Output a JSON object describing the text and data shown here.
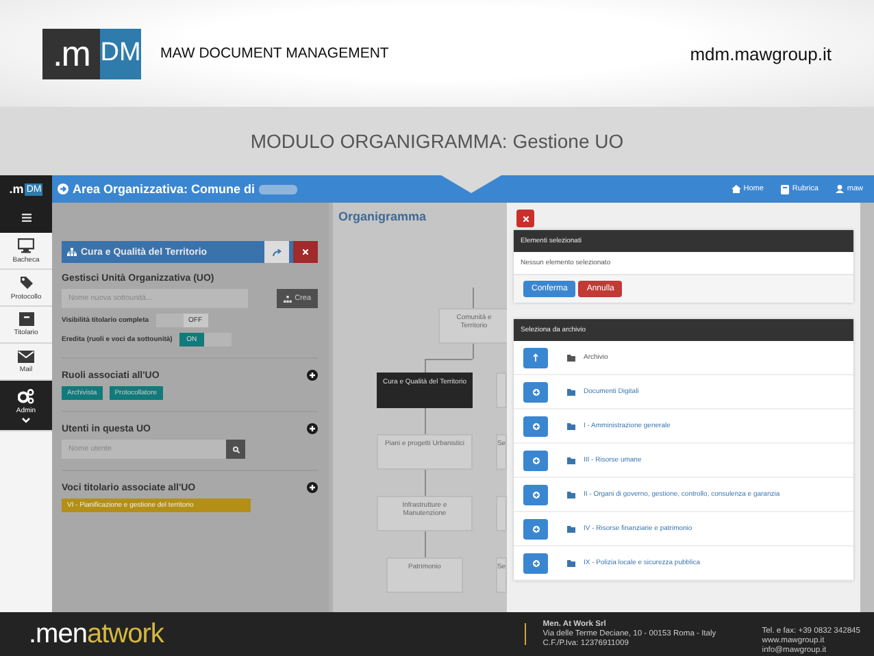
{
  "slide_header": {
    "logo": [
      ".m",
      "DM"
    ],
    "title": "MAW DOCUMENT MANAGEMENT",
    "url": "mdm.mawgroup.it"
  },
  "slide_title": "MODULO ORGANIGRAMMA: Gestione UO",
  "app": {
    "logo": [
      ".m",
      "DM"
    ],
    "topbar": {
      "title": "Area Organizzativa: Comune di",
      "links": [
        {
          "label": "Home"
        },
        {
          "label": "Rubrica"
        },
        {
          "label": "maw"
        }
      ]
    },
    "sidebar": [
      {
        "label": "Bacheca",
        "selected": false
      },
      {
        "label": "Protocollo",
        "selected": false
      },
      {
        "label": "Titolario",
        "selected": false
      },
      {
        "label": "Mail",
        "selected": false
      },
      {
        "label": "Admin",
        "selected": true
      }
    ],
    "uo_panel": {
      "title": "Cura e Qualità del Territorio",
      "section": "Gestisci Unità Organizzativa (UO)",
      "name_placeholder": "Nome nuova sottounità...",
      "create_button": "Crea",
      "toggles": [
        {
          "label": "Visibilità titolario completa",
          "on": false,
          "state_label": "OFF"
        },
        {
          "label": "Eredita (ruoli e voci da sottounità)",
          "on": true,
          "state_label": "ON"
        }
      ],
      "roles": {
        "title": "Ruoli associati all'UO",
        "tags": [
          "Archivista",
          "Protocollatore"
        ]
      },
      "users": {
        "title": "Utenti in questa UO",
        "placeholder": "Nome utente"
      },
      "titolario": {
        "title": "Voci titolario associate all'UO",
        "tags": [
          "VI - Pianificazione e gestione del territorio"
        ]
      }
    },
    "organigram": {
      "title": "Organigramma",
      "root": {
        "label": "Comunità e Territorio",
        "selected": false,
        "children": [
          {
            "label": "Cura e Qualità del Territorio",
            "selected": true,
            "children": [
              {
                "label": "Piani e progetti Urbanistici",
                "selected": false
              },
              {
                "label": "Infrastrutture e Manutenzione",
                "selected": false
              },
              {
                "label": "Patrimonio",
                "selected": false
              }
            ]
          },
          {
            "selected": false,
            "children": [
              {
                "label": "Se",
                "selected": false
              },
              {
                "selected": false
              },
              {
                "label": "Se",
                "selected": false
              }
            ]
          }
        ]
      }
    },
    "modal": {
      "selected_card": {
        "title": "Elementi selezionati",
        "empty_text": "Nessun elemento selezionato",
        "buttons": [
          {
            "label": "Conferma",
            "kind": "primary"
          },
          {
            "label": "Annulla",
            "kind": "danger"
          }
        ]
      },
      "archive_card": {
        "title": "Seleziona da archivio",
        "root": "Archivio",
        "items": [
          "Documenti Digitali",
          "I - Amministrazione generale",
          "III - Risorse umane",
          "II - Organi di governo, gestione, controllo, consulenza e garanzia",
          "IV - Risorse finanziarie e patrimonio",
          "IX - Polizia locale e sicurezza pubblica"
        ]
      }
    }
  },
  "footer": {
    "logo": [
      ".men",
      "at",
      "work"
    ],
    "company": [
      "Men. At Work Srl",
      "Via delle Terme Deciane, 10 - 00153 Roma - Italy",
      "C.F./P.Iva: 12376911009"
    ],
    "contacts": [
      "Tel. e fax: +39 0832 342845",
      "www.mawgroup.it",
      "info@mawgroup.it"
    ]
  }
}
